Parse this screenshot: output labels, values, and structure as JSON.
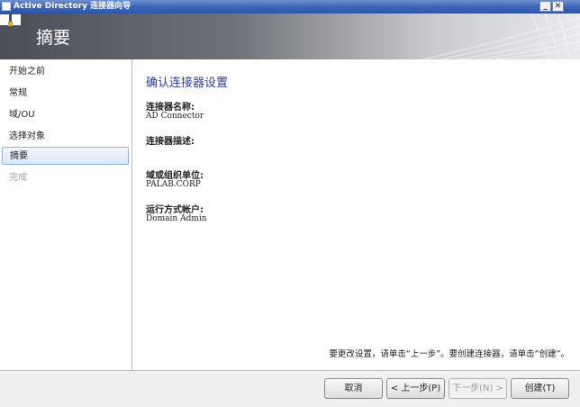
{
  "window": {
    "title": "Active Directory 连接器向导",
    "minimize_glyph": "_",
    "close_glyph": "✕"
  },
  "header": {
    "title": "摘要",
    "icon": "wizard-pages-icon"
  },
  "sidebar": {
    "items": [
      {
        "label": "开始之前",
        "state": "normal"
      },
      {
        "label": "常规",
        "state": "normal"
      },
      {
        "label": "域/OU",
        "state": "normal"
      },
      {
        "label": "选择对象",
        "state": "normal"
      },
      {
        "label": "摘要",
        "state": "active"
      },
      {
        "label": "完成",
        "state": "disabled"
      }
    ]
  },
  "main": {
    "section_title": "确认连接器设置",
    "fields": [
      {
        "label": "连接器名称:",
        "value": "AD Connector"
      },
      {
        "label": "连接器描述:",
        "value": ""
      },
      {
        "label": "域或组织单位:",
        "value": "PALAB.CORP"
      },
      {
        "label": "运行方式帐户:",
        "value": "Domain Admin"
      }
    ],
    "note": "要更改设置，请单击“上一步”。要创建连接器，请单击“创建”。"
  },
  "footer": {
    "cancel_label": "取消",
    "back_label": "< 上一步(P)",
    "next_label": "下一步(N) >",
    "create_label": "创建(T)"
  },
  "colors": {
    "accent_title": "#2b3f9c",
    "titlebar": "#3d66b8",
    "active_nav": "#d9e8fa"
  }
}
